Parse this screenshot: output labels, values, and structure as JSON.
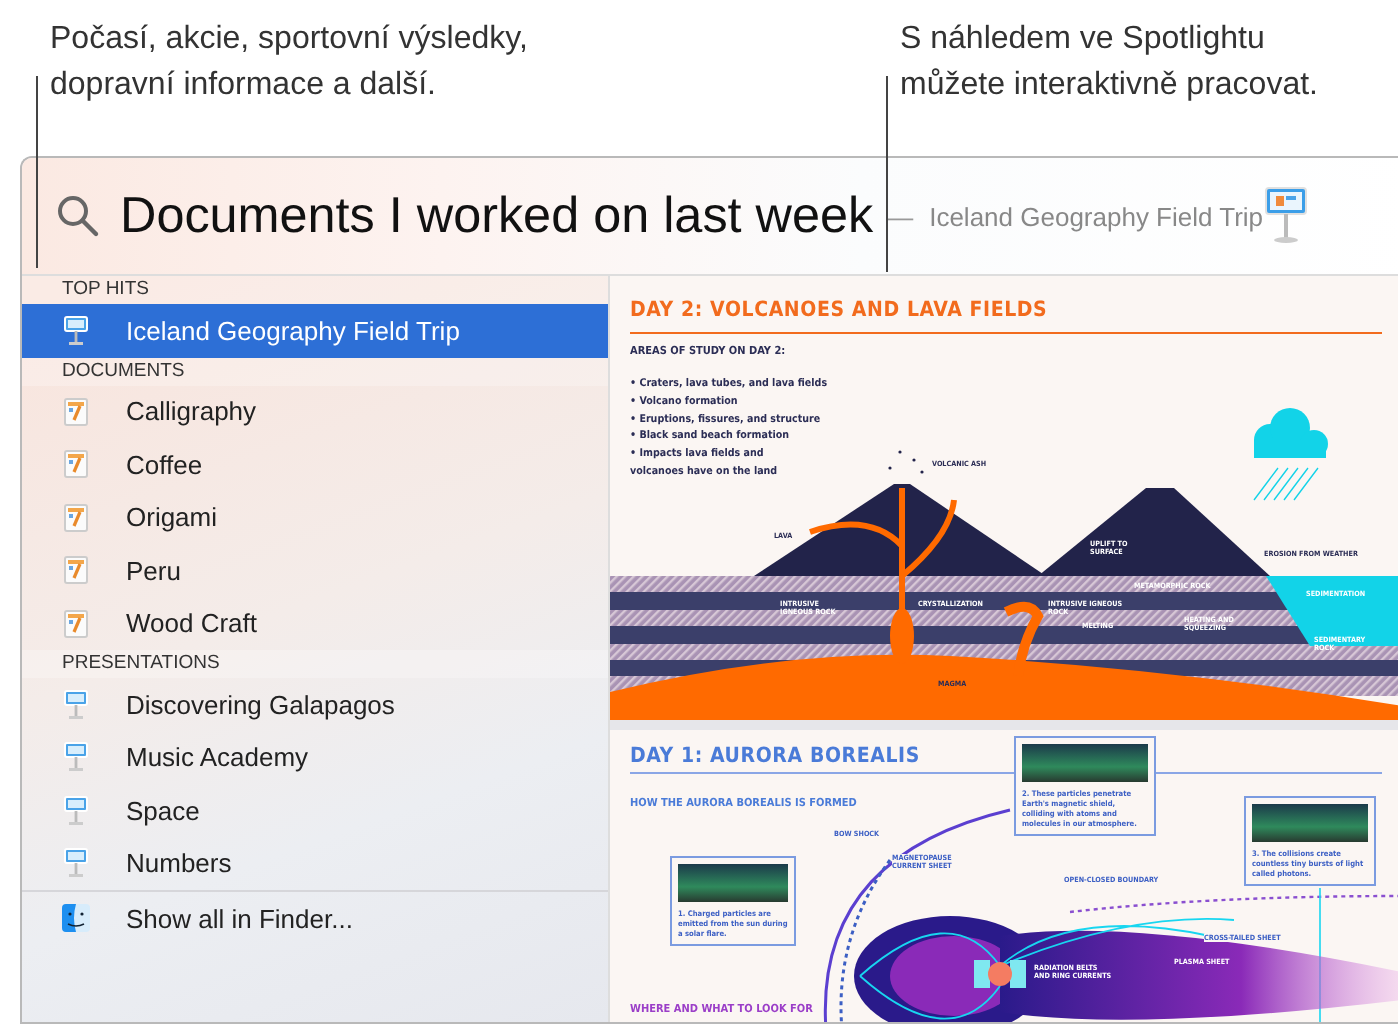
{
  "callouts": [
    {
      "text": "Počasí, akcie, sportovní výsledky, dopravní informace a další."
    },
    {
      "text": "S náhledem ve Spotlightu můžete interaktivně pracovat."
    }
  ],
  "search": {
    "query": "Documents I worked on last week",
    "dash": "—",
    "suggestion": "Iceland Geography Field Trip"
  },
  "results": [
    {
      "header": "TOP HITS",
      "items": [
        {
          "label": "Iceland Geography Field Trip",
          "kind": "keynote",
          "selected": true
        }
      ]
    },
    {
      "header": "DOCUMENTS",
      "items": [
        {
          "label": "Calligraphy",
          "kind": "pages",
          "selected": false
        },
        {
          "label": "Coffee",
          "kind": "pages",
          "selected": false
        },
        {
          "label": "Origami",
          "kind": "pages",
          "selected": false
        },
        {
          "label": "Peru",
          "kind": "pages",
          "selected": false
        },
        {
          "label": "Wood Craft",
          "kind": "pages",
          "selected": false
        }
      ]
    },
    {
      "header": "PRESENTATIONS",
      "items": [
        {
          "label": "Discovering Galapagos",
          "kind": "keynote",
          "selected": false
        },
        {
          "label": "Music Academy",
          "kind": "keynote",
          "selected": false
        },
        {
          "label": "Space",
          "kind": "keynote",
          "selected": false
        },
        {
          "label": "Numbers",
          "kind": "keynote",
          "selected": false
        }
      ]
    }
  ],
  "footer": {
    "label": "Show all in Finder...",
    "kind": "finder"
  },
  "preview": {
    "day2": {
      "title": "DAY 2: VOLCANOES AND LAVA FIELDS",
      "subtitle": "AREAS OF STUDY ON DAY 2:",
      "bullets": [
        "• Craters, lava tubes, and lava fields",
        "• Volcano formation",
        "• Eruptions, fissures, and structure",
        "• Black sand beach formation",
        "• Impacts lava fields and volcanoes have on the land"
      ],
      "labels": [
        "VOLCANIC ASH",
        "LAVA",
        "UPLIFT TO SURFACE",
        "EROSION FROM WEATHER",
        "SEDIMENTATION",
        "INTRUSIVE IGNEOUS ROCK",
        "CRYSTALLIZATION",
        "INTRUSIVE IGNEOUS ROCK",
        "METAMORPHIC ROCK",
        "MELTING",
        "HEATING AND SQUEEZING",
        "SEDIMENTARY ROCK",
        "MAGMA"
      ]
    },
    "day1": {
      "title": "DAY 1: AURORA BOREALIS",
      "subtitle": "HOW THE AURORA BOREALIS IS FORMED",
      "captions": [
        "1. Charged particles are emitted from the sun during a solar flare.",
        "2. These particles penetrate Earth's magnetic shield, colliding with atoms and molecules in our atmosphere.",
        "3. The collisions create countless tiny bursts of light called photons."
      ],
      "labels": [
        "BOW SHOCK",
        "MAGNETOPAUSE CURRENT SHEET",
        "OPEN-CLOSED BOUNDARY",
        "CROSS-TAILED SHEET",
        "PLASMA SHEET",
        "RADIATION BELTS AND RING CURRENTS"
      ],
      "footer": "WHERE AND WHAT TO LOOK FOR"
    }
  }
}
